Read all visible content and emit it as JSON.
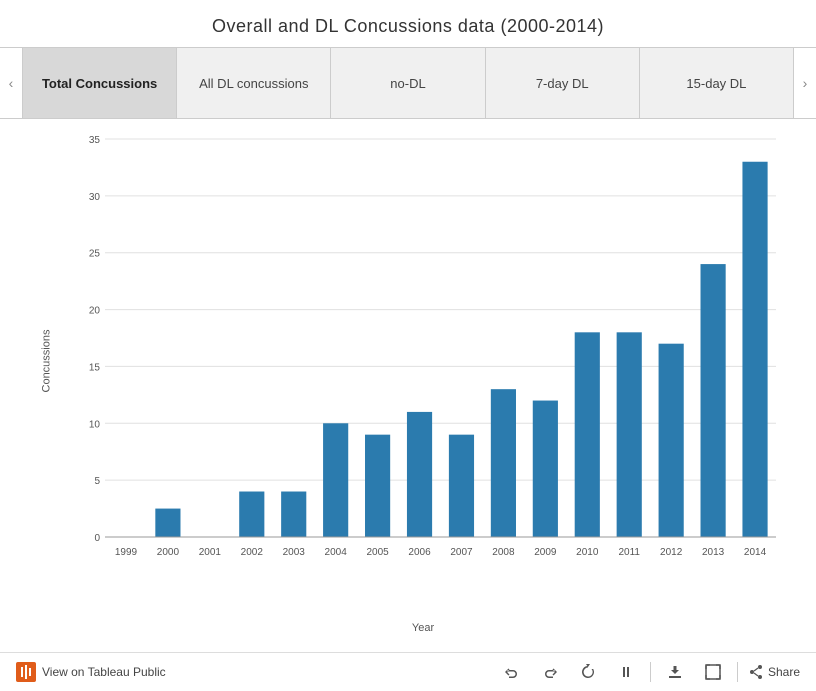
{
  "title": "Overall and DL Concussions data (2000-2014)",
  "tabs": [
    {
      "label": "Total Concussions",
      "active": true
    },
    {
      "label": "All DL concussions",
      "active": false
    },
    {
      "label": "no-DL",
      "active": false
    },
    {
      "label": "7-day DL",
      "active": false
    },
    {
      "label": "15-day DL",
      "active": false
    }
  ],
  "chart": {
    "y_axis_label": "Concussions",
    "x_axis_label": "Year",
    "bar_color": "#2b7bae",
    "y_max": 35,
    "y_ticks": [
      0,
      5,
      10,
      15,
      20,
      25,
      30,
      35
    ],
    "bars": [
      {
        "year": "1999",
        "value": 0
      },
      {
        "year": "2000",
        "value": 2.5
      },
      {
        "year": "2001",
        "value": 0
      },
      {
        "year": "2002",
        "value": 4
      },
      {
        "year": "2003",
        "value": 4
      },
      {
        "year": "2004",
        "value": 10
      },
      {
        "year": "2005",
        "value": 9
      },
      {
        "year": "2006",
        "value": 11
      },
      {
        "year": "2007",
        "value": 9
      },
      {
        "year": "2008",
        "value": 13
      },
      {
        "year": "2009",
        "value": 12
      },
      {
        "year": "2010",
        "value": 18
      },
      {
        "year": "2011",
        "value": 18
      },
      {
        "year": "2012",
        "value": 17
      },
      {
        "year": "2013",
        "value": 24
      },
      {
        "year": "2014",
        "value": 33
      }
    ]
  },
  "footer": {
    "tableau_link": "View on Tableau Public",
    "share_label": "Share"
  },
  "arrows": {
    "left": "‹",
    "right": "›"
  }
}
